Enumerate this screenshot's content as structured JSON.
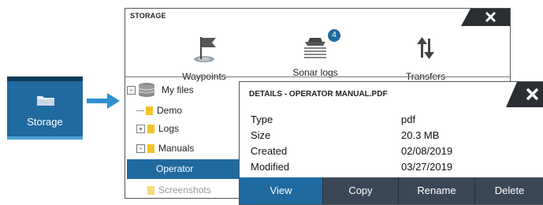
{
  "storage_tile": {
    "label": "Storage",
    "icon": "folder-icon"
  },
  "storage_window": {
    "title": "STORAGE",
    "toolbar": [
      {
        "label": "Waypoints",
        "icon": "waypoints-flag-icon"
      },
      {
        "label": "Sonar logs",
        "icon": "sonar-boat-icon",
        "badge": "4"
      },
      {
        "label": "Transfers",
        "icon": "transfer-arrows-icon"
      }
    ],
    "tree": [
      {
        "label": "My files",
        "icon": "database-icon",
        "expander": "-"
      },
      {
        "label": "Demo",
        "icon": "folder-icon"
      },
      {
        "label": "Logs",
        "icon": "folder-icon",
        "expander": "+"
      },
      {
        "label": "Manuals",
        "icon": "folder-icon",
        "expander": "-"
      },
      {
        "label": "Operator Manual.pdf",
        "selected": true
      },
      {
        "label": "Screenshots",
        "icon": "folder-icon"
      }
    ]
  },
  "details": {
    "title": "DETAILS - OPERATOR MANUAL.PDF",
    "properties": [
      {
        "name": "Type",
        "value": "pdf"
      },
      {
        "name": "Size",
        "value": "20.3 MB"
      },
      {
        "name": "Created",
        "value": "02/08/2019"
      },
      {
        "name": "Modified",
        "value": "03/27/2019"
      }
    ],
    "buttons": [
      "View",
      "Copy",
      "Rename",
      "Delete"
    ]
  },
  "colors": {
    "accent": "#1f6aa0",
    "badge": "#1f6aa0",
    "button_bar": "#3a4856",
    "title_bar": "#2b2f33"
  }
}
